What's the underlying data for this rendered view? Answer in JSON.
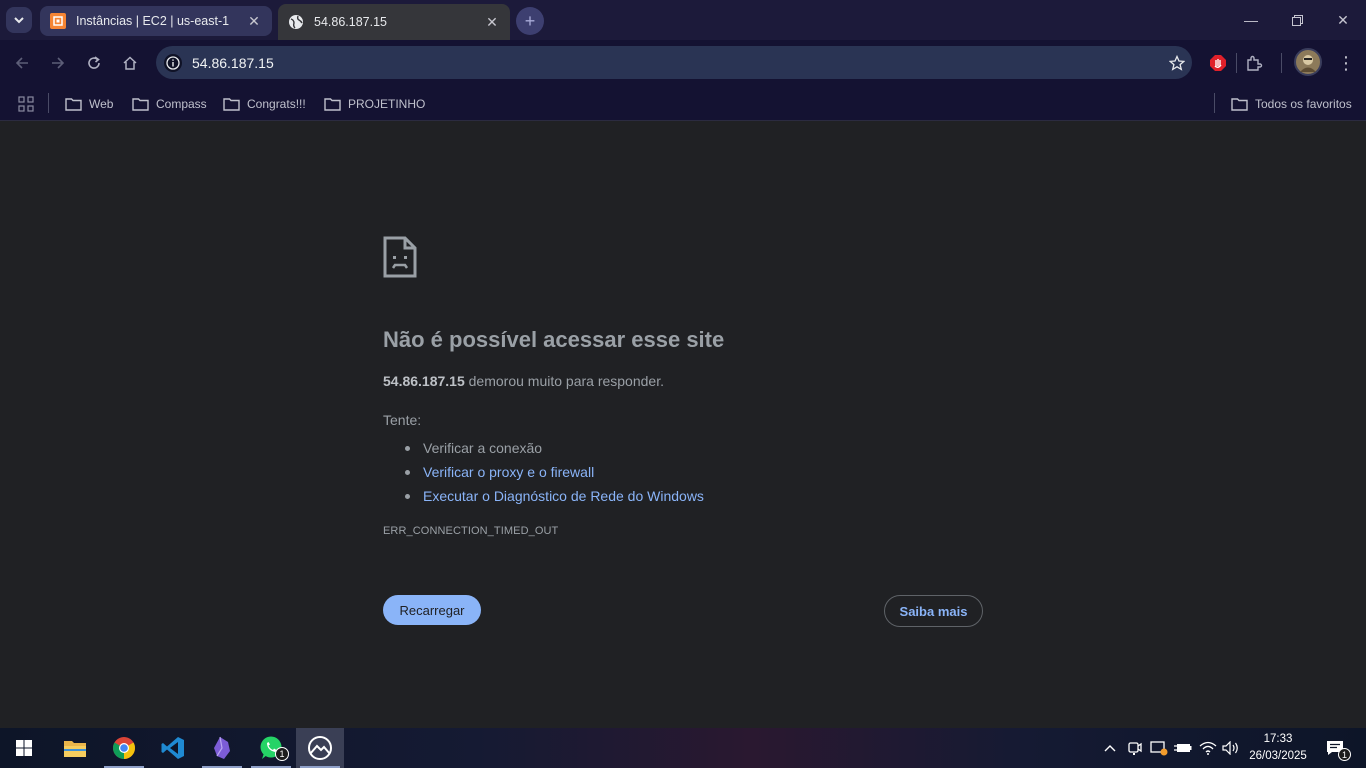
{
  "browser": {
    "tabs": [
      {
        "title": "Instâncias | EC2 | us-east-1",
        "favicon": "aws-ec2-icon",
        "active": false
      },
      {
        "title": "54.86.187.15",
        "favicon": "globe-icon",
        "active": true
      }
    ],
    "address": "54.86.187.15",
    "bookmarks": [
      {
        "label": "Web"
      },
      {
        "label": "Compass"
      },
      {
        "label": "Congrats!!!"
      },
      {
        "label": "PROJETINHO"
      }
    ],
    "all_bookmarks_label": "Todos os favoritos"
  },
  "error_page": {
    "title": "Não é possível acessar esse site",
    "host": "54.86.187.15",
    "desc_suffix": " demorou muito para responder.",
    "try_label": "Tente:",
    "suggestions": [
      "Verificar a conexão",
      "Verificar o proxy e o firewall",
      "Executar o Diagnóstico de Rede do Windows"
    ],
    "error_code": "ERR_CONNECTION_TIMED_OUT",
    "reload_label": "Recarregar",
    "more_label": "Saiba mais"
  },
  "taskbar": {
    "apps": [
      "windows-start-icon",
      "file-explorer-icon",
      "chrome-icon",
      "vscode-icon",
      "obsidian-icon",
      "whatsapp-icon",
      "app-mountain-icon"
    ],
    "whatsapp_badge": "1",
    "time": "17:33",
    "date": "26/03/2025",
    "notification_badge": "1"
  },
  "colors": {
    "page_bg": "#202124",
    "link": "#8ab4f8",
    "tabstrip": "#1c1a3a",
    "toolbar": "#141232"
  }
}
